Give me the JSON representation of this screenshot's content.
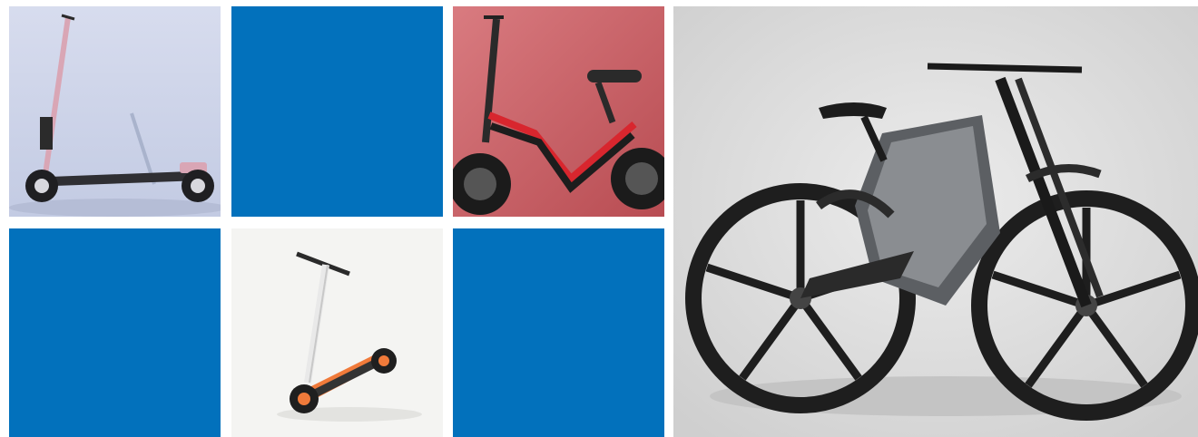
{
  "colors": {
    "tile_blue": "#0271BC",
    "background": "#ffffff"
  },
  "tiles": [
    {
      "kind": "image",
      "subject": "pink-kick-scooter"
    },
    {
      "kind": "color",
      "color": "#0271BC"
    },
    {
      "kind": "image",
      "subject": "seated-e-bike-red-background"
    },
    {
      "kind": "color",
      "color": "#0271BC"
    },
    {
      "kind": "image",
      "subject": "orange-kick-scooter"
    },
    {
      "kind": "color",
      "color": "#0271BC"
    },
    {
      "kind": "image",
      "subject": "electric-mountain-bike"
    }
  ]
}
